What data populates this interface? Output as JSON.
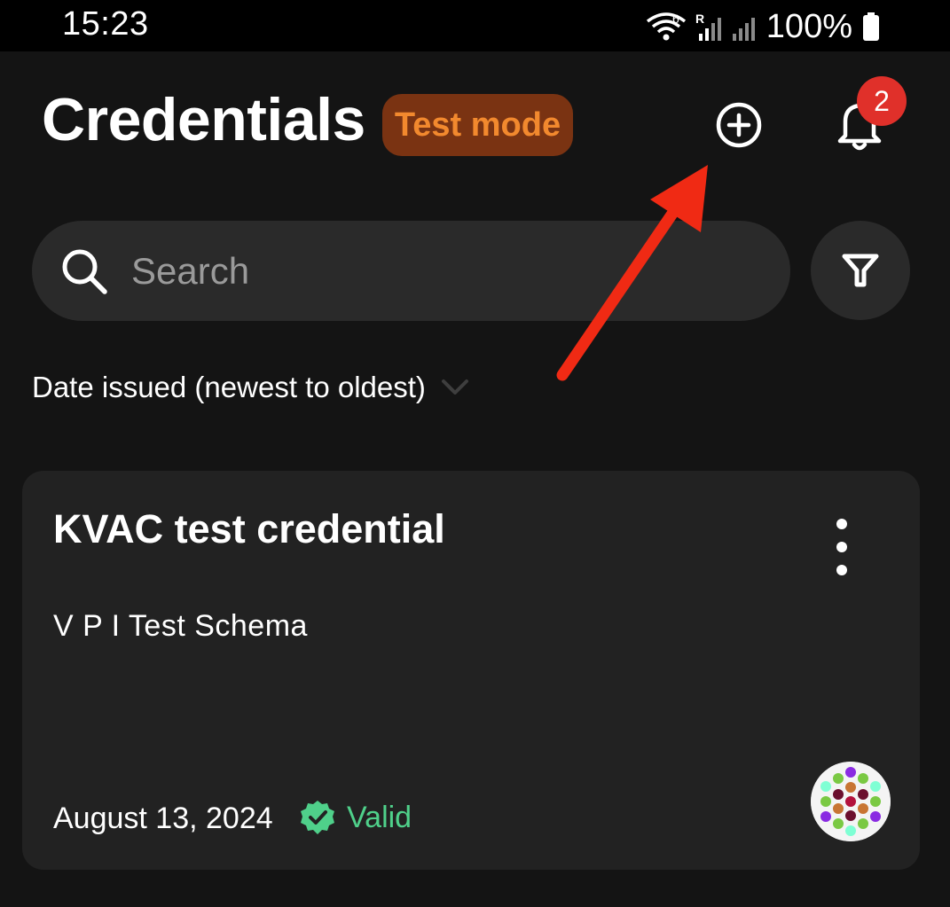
{
  "status_bar": {
    "time": "15:23",
    "battery": "100%",
    "icons": [
      "wifi-icon",
      "signal-roaming-icon",
      "signal-icon",
      "battery-icon"
    ]
  },
  "header": {
    "title": "Credentials",
    "mode_badge": "Test mode",
    "add_icon": "add-circle-icon",
    "notifications_icon": "bell-icon",
    "notification_count": "2"
  },
  "search": {
    "placeholder": "Search",
    "value": "",
    "filter_icon": "filter-icon"
  },
  "sort": {
    "label": "Date issued (newest to oldest)",
    "icon": "chevron-down-icon"
  },
  "credentials": [
    {
      "title": "KVAC test credential",
      "schema": "V P I Test Schema",
      "date": "August 13, 2024",
      "status": "Valid",
      "status_icon": "verified-badge-icon",
      "avatar": "issuer-avatar"
    }
  ],
  "colors": {
    "background": "#141414",
    "surface": "#2a2a2a",
    "card": "#222222",
    "badge_bg": "#7a3312",
    "badge_text": "#f2892e",
    "notification": "#e0302a",
    "valid": "#4fd08a",
    "annotation_arrow": "#f02a14"
  }
}
